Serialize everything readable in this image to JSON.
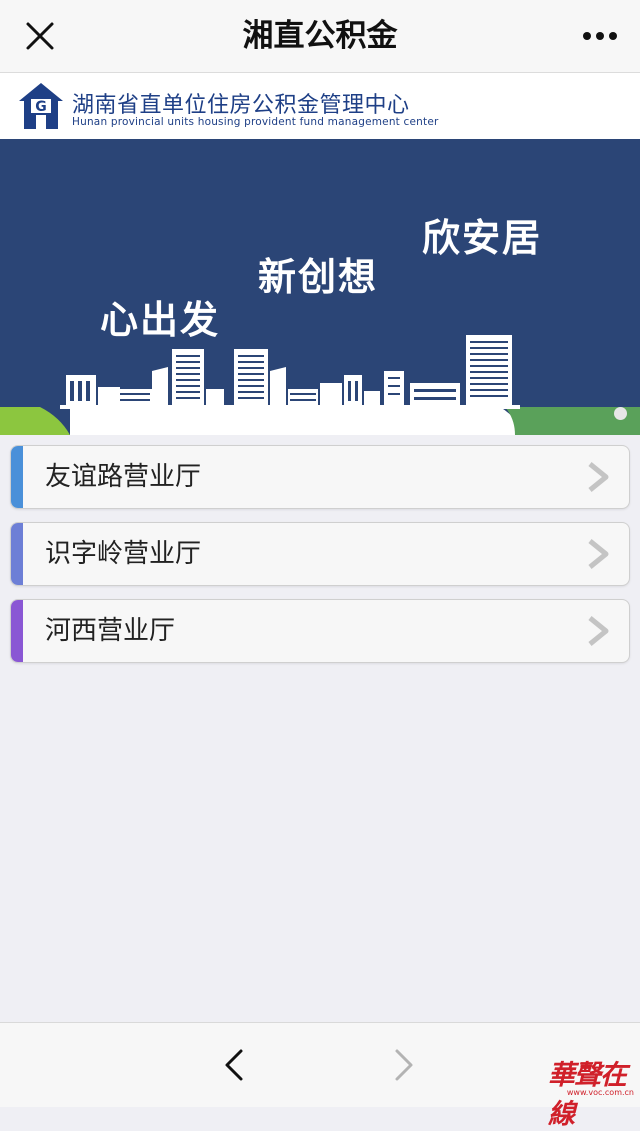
{
  "topbar": {
    "title": "湘直公积金",
    "close_icon": "close-icon",
    "more_icon": "more-icon"
  },
  "org": {
    "name_cn": "湖南省直单位住房公积金管理中心",
    "name_en": "Hunan provincial units housing provident fund management center",
    "logo_letter": "G",
    "brand_color": "#1e3f86"
  },
  "banner": {
    "slogans": [
      "心出发",
      "新创想",
      "欣安居"
    ],
    "background": "#2b4576"
  },
  "halls": [
    {
      "label": "友谊路营业厅",
      "accent": "#4a90d9"
    },
    {
      "label": "识字岭营业厅",
      "accent": "#6d7fd6"
    },
    {
      "label": "河西营业厅",
      "accent": "#8a57d4"
    }
  ],
  "bottombar": {
    "back_icon": "back-arrow-icon",
    "forward_icon": "forward-arrow-icon"
  },
  "watermark": {
    "text": "華聲在線",
    "url": "www.voc.com.cn"
  }
}
